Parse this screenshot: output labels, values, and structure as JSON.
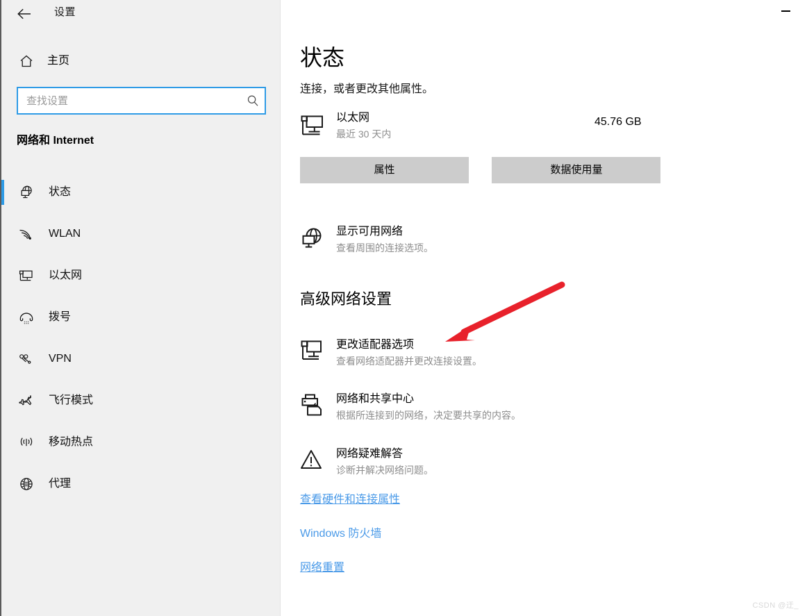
{
  "window": {
    "title": "设置",
    "back_icon": "back-arrow-icon",
    "minimize_label": "—"
  },
  "sidebar": {
    "home": {
      "label": "主页",
      "icon": "home-icon"
    },
    "search": {
      "value": "",
      "placeholder": "查找设置",
      "icon": "search-icon"
    },
    "category_title": "网络和 Internet",
    "items": [
      {
        "label": "状态",
        "icon": "status-globe-icon",
        "selected": true
      },
      {
        "label": "WLAN",
        "icon": "wifi-icon",
        "selected": false
      },
      {
        "label": "以太网",
        "icon": "ethernet-icon",
        "selected": false
      },
      {
        "label": "拨号",
        "icon": "dialup-phone-icon",
        "selected": false
      },
      {
        "label": "VPN",
        "icon": "vpn-icon",
        "selected": false
      },
      {
        "label": "飞行模式",
        "icon": "airplane-icon",
        "selected": false
      },
      {
        "label": "移动热点",
        "icon": "mobile-hotspot-icon",
        "selected": false
      },
      {
        "label": "代理",
        "icon": "proxy-globe-icon",
        "selected": false
      }
    ]
  },
  "main": {
    "page_title": "状态",
    "page_subtitle": "连接，或者更改其他属性。",
    "connection": {
      "name": "以太网",
      "period": "最近 30 天内",
      "usage": "45.76 GB",
      "icon": "ethernet-monitor-icon"
    },
    "buttons": {
      "properties": "属性",
      "data_usage": "数据使用量"
    },
    "show_networks": {
      "title": "显示可用网络",
      "desc": "查看周围的连接选项。",
      "icon": "available-networks-globe-icon"
    },
    "advanced_title": "高级网络设置",
    "advanced_items": [
      {
        "title": "更改适配器选项",
        "desc": "查看网络适配器并更改连接设置。",
        "icon": "adapter-monitor-icon"
      },
      {
        "title": "网络和共享中心",
        "desc": "根据所连接到的网络，决定要共享的内容。",
        "icon": "sharing-center-icon"
      },
      {
        "title": "网络疑难解答",
        "desc": "诊断并解决网络问题。",
        "icon": "troubleshoot-warning-icon"
      }
    ],
    "links": [
      {
        "label": "查看硬件和连接属性",
        "underlined": true
      },
      {
        "label": "Windows 防火墙",
        "underlined": false
      },
      {
        "label": "网络重置",
        "underlined": true
      }
    ]
  },
  "annotation": {
    "arrow_color": "#e8212b",
    "target": "更改适配器选项"
  },
  "watermark": "CSDN @迂_",
  "colors": {
    "accent": "#2e9be6",
    "link": "#4a9ae8",
    "sidebar_bg": "#f0f0f0",
    "button_bg": "#cccccc",
    "arrow_red": "#e8212b"
  }
}
